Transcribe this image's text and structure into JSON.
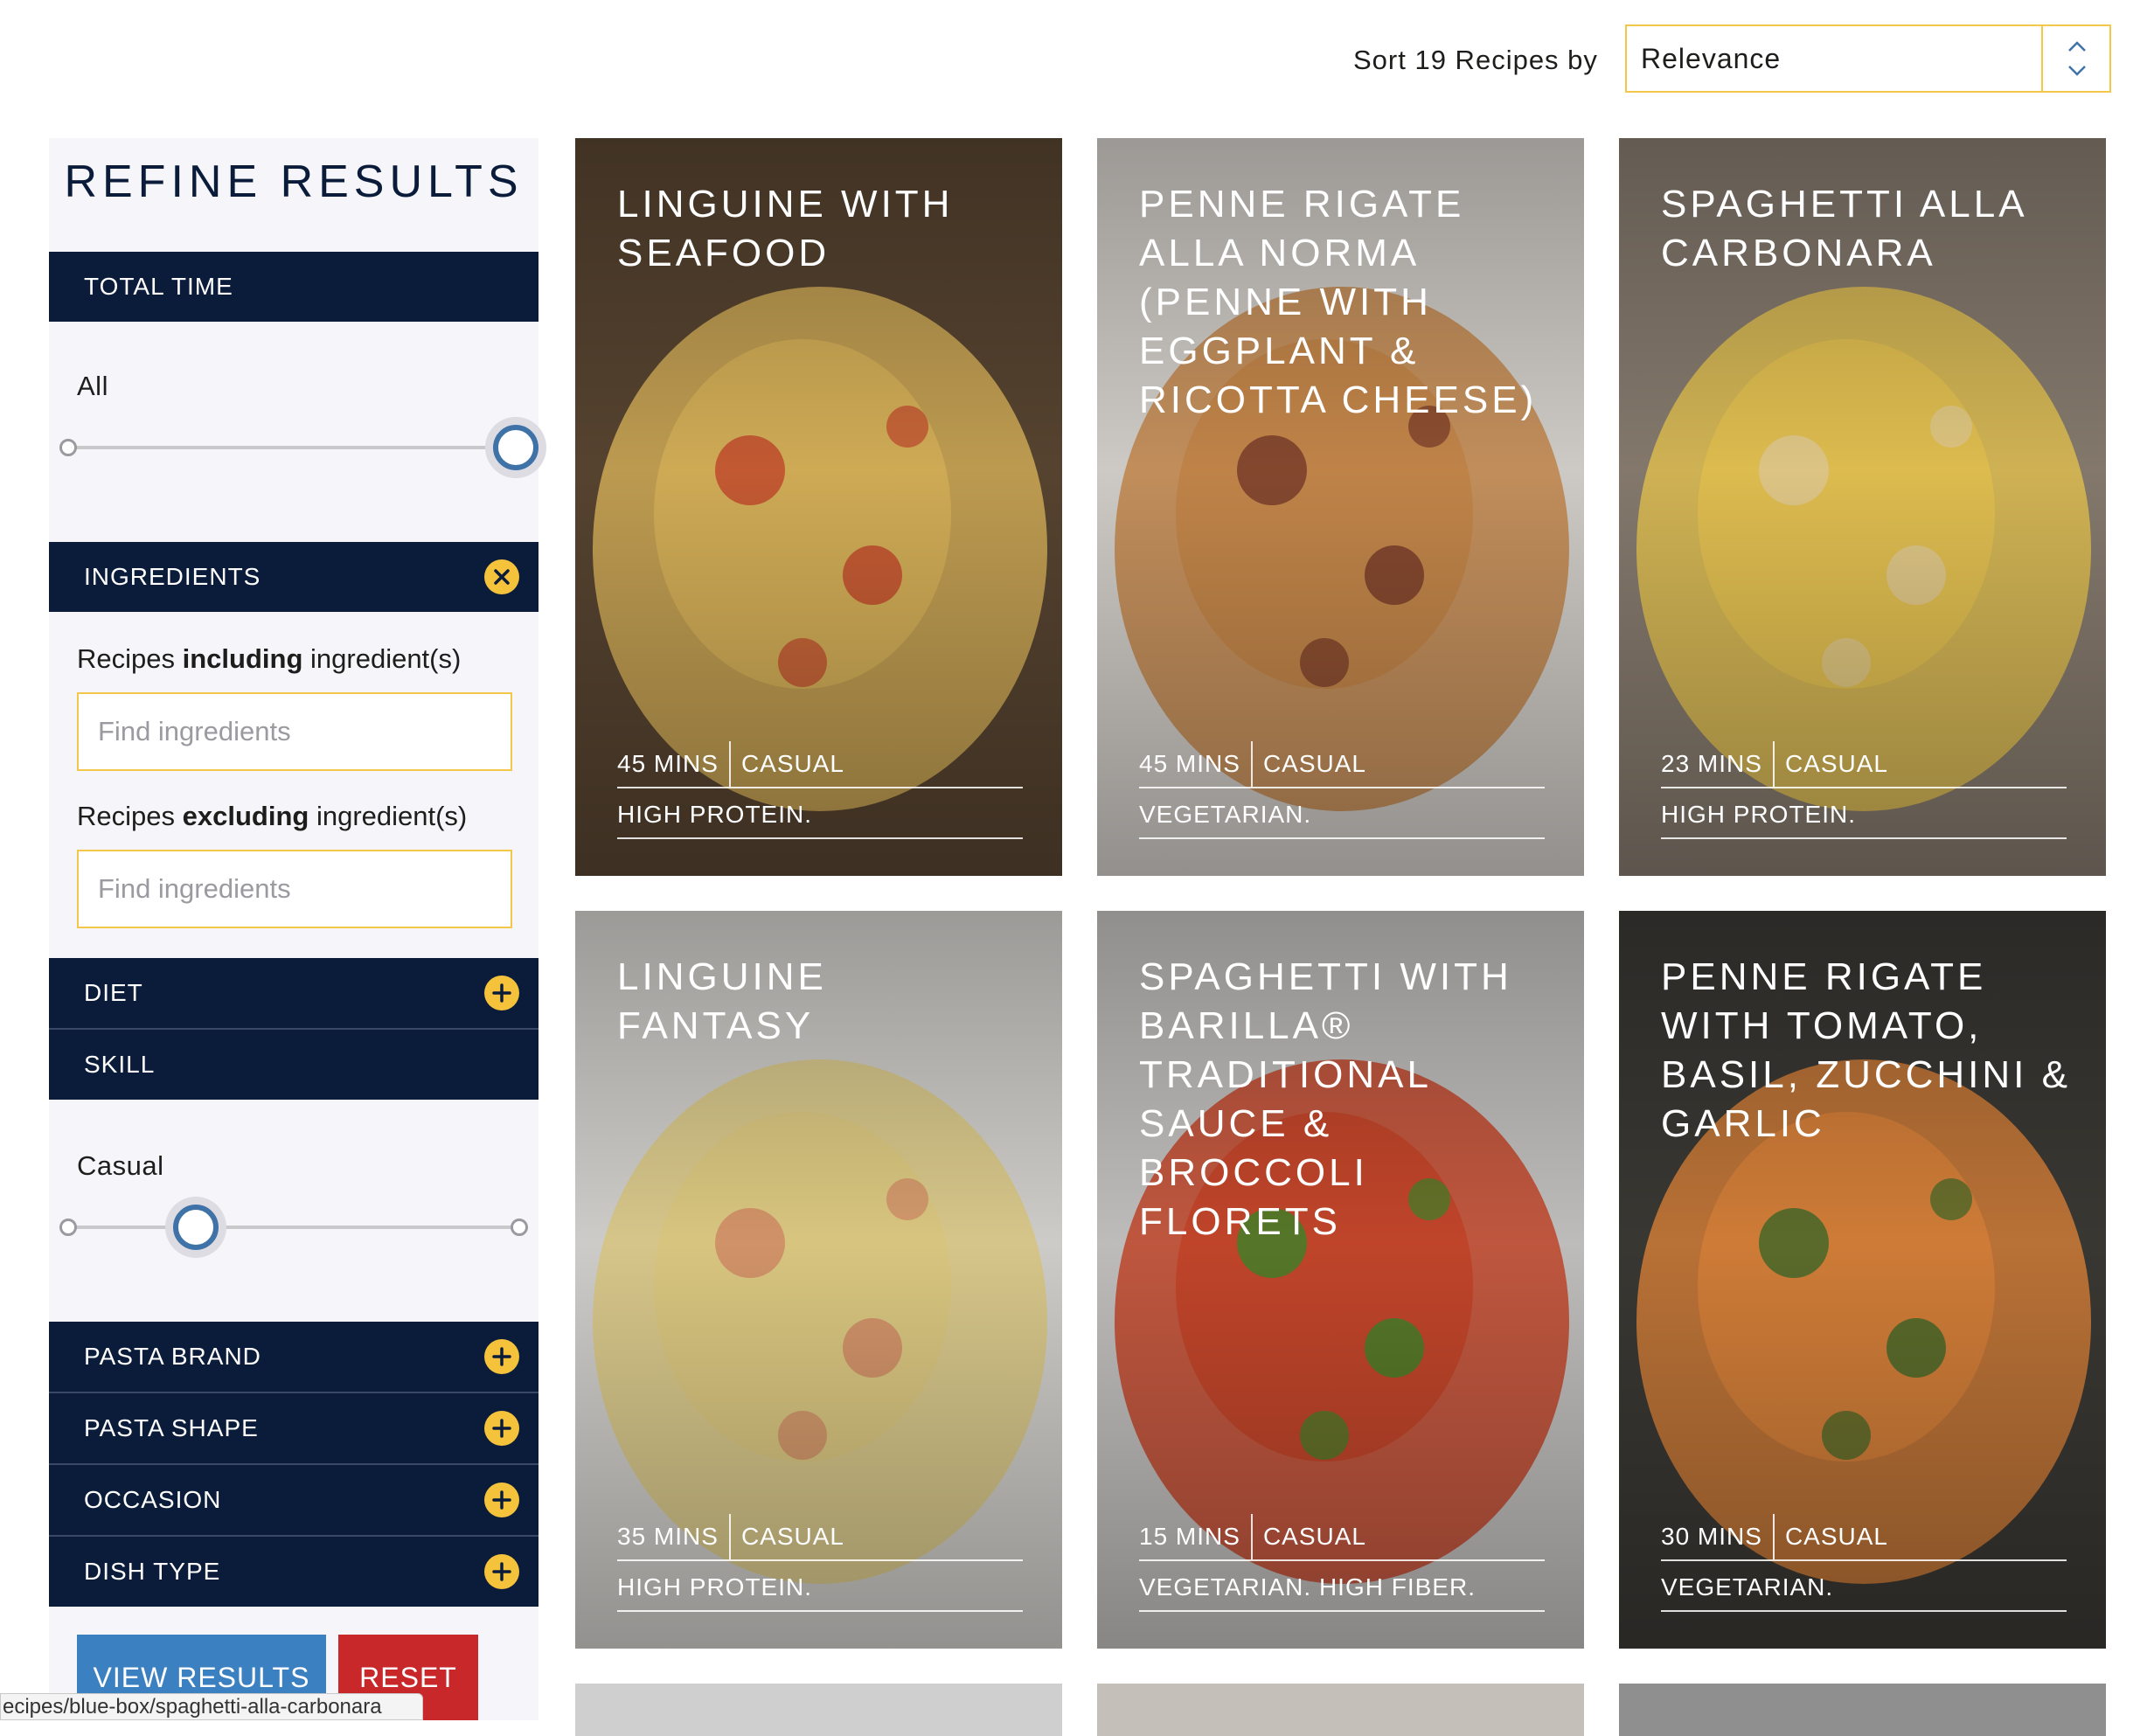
{
  "sort": {
    "label": "Sort 19 Recipes by",
    "selected": "Relevance"
  },
  "sidebar": {
    "title": "REFINE RESULTS",
    "total_time": {
      "header": "TOTAL TIME",
      "value": "All",
      "slider_position": 1.0
    },
    "ingredients": {
      "header": "INGREDIENTS",
      "icon": "close-icon",
      "including_prefix": "Recipes",
      "including_bold": "including",
      "including_suffix": "ingredient(s)",
      "including_placeholder": "Find ingredients",
      "excluding_prefix": "Recipes",
      "excluding_bold": "excluding",
      "excluding_suffix": "ingredient(s)",
      "excluding_placeholder": "Find ingredients"
    },
    "diet": {
      "header": "DIET",
      "icon": "plus-icon"
    },
    "skill": {
      "header": "SKILL",
      "value": "Casual",
      "slider_position": 0.28
    },
    "pasta_brand": {
      "header": "PASTA BRAND",
      "icon": "plus-icon"
    },
    "pasta_shape": {
      "header": "PASTA SHAPE",
      "icon": "plus-icon"
    },
    "occasion": {
      "header": "OCCASION",
      "icon": "plus-icon"
    },
    "dish_type": {
      "header": "DISH TYPE",
      "icon": "plus-icon"
    },
    "view_results": "VIEW RESULTS",
    "reset": "RESET"
  },
  "status_url": "ecipes/blue-box/spaghetti-alla-carbonara",
  "recipes": [
    {
      "title": "LINGUINE WITH SEAFOOD",
      "time": "45 MINS",
      "skill": "CASUAL",
      "tags": "HIGH PROTEIN."
    },
    {
      "title": "PENNE RIGATE ALLA NORMA (PENNE WITH EGGPLANT & RICOTTA CHEESE)",
      "time": "45 MINS",
      "skill": "CASUAL",
      "tags": "VEGETARIAN."
    },
    {
      "title": "SPAGHETTI ALLA CARBONARA",
      "time": "23 MINS",
      "skill": "CASUAL",
      "tags": "HIGH PROTEIN."
    },
    {
      "title": "LINGUINE FANTASY",
      "time": "35 MINS",
      "skill": "CASUAL",
      "tags": "HIGH PROTEIN."
    },
    {
      "title": "SPAGHETTI WITH BARILLA® TRADITIONAL SAUCE & BROCCOLI FLORETS",
      "time": "15 MINS",
      "skill": "CASUAL",
      "tags": "VEGETARIAN.  HIGH FIBER."
    },
    {
      "title": "PENNE RIGATE WITH TOMATO, BASIL, ZUCCHINI & GARLIC",
      "time": "30 MINS",
      "skill": "CASUAL",
      "tags": "VEGETARIAN."
    }
  ],
  "colors": {
    "navy": "#0b1c3a",
    "accent_yellow": "#f5c33b",
    "input_border": "#f2c74a",
    "view_results_blue": "#3b80c0",
    "reset_red": "#c8282a",
    "slider_blue": "#3f73a8"
  }
}
